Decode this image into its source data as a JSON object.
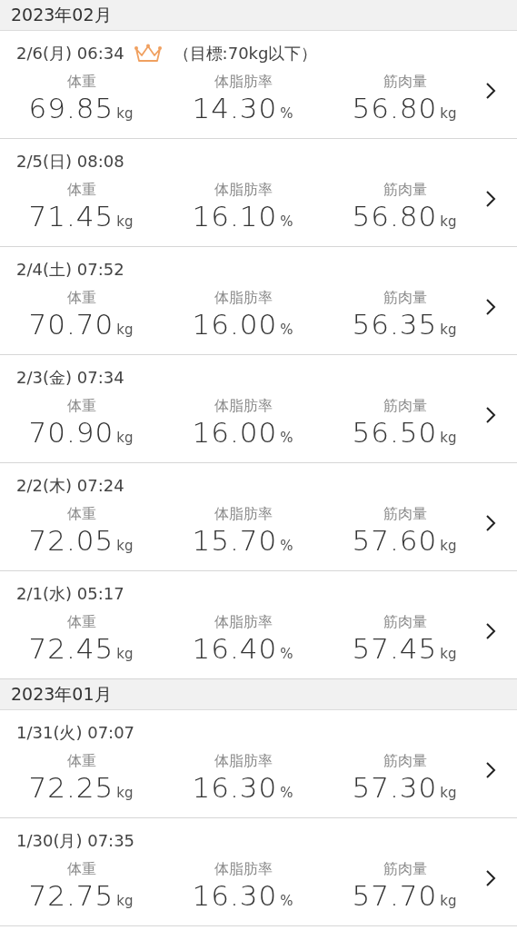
{
  "sections": [
    {
      "month": "2023年02月",
      "records": [
        {
          "datetime": "2/6(月) 06:34",
          "goal": "（目標:70kg以下）",
          "metrics": [
            {
              "label": "体重",
              "value": "69.85",
              "unit": "kg"
            },
            {
              "label": "体脂肪率",
              "value": "14.30",
              "unit": "%"
            },
            {
              "label": "筋肉量",
              "value": "56.80",
              "unit": "kg"
            }
          ]
        },
        {
          "datetime": "2/5(日) 08:08",
          "metrics": [
            {
              "label": "体重",
              "value": "71.45",
              "unit": "kg"
            },
            {
              "label": "体脂肪率",
              "value": "16.10",
              "unit": "%"
            },
            {
              "label": "筋肉量",
              "value": "56.80",
              "unit": "kg"
            }
          ]
        },
        {
          "datetime": "2/4(土) 07:52",
          "metrics": [
            {
              "label": "体重",
              "value": "70.70",
              "unit": "kg"
            },
            {
              "label": "体脂肪率",
              "value": "16.00",
              "unit": "%"
            },
            {
              "label": "筋肉量",
              "value": "56.35",
              "unit": "kg"
            }
          ]
        },
        {
          "datetime": "2/3(金) 07:34",
          "metrics": [
            {
              "label": "体重",
              "value": "70.90",
              "unit": "kg"
            },
            {
              "label": "体脂肪率",
              "value": "16.00",
              "unit": "%"
            },
            {
              "label": "筋肉量",
              "value": "56.50",
              "unit": "kg"
            }
          ]
        },
        {
          "datetime": "2/2(木) 07:24",
          "metrics": [
            {
              "label": "体重",
              "value": "72.05",
              "unit": "kg"
            },
            {
              "label": "体脂肪率",
              "value": "15.70",
              "unit": "%"
            },
            {
              "label": "筋肉量",
              "value": "57.60",
              "unit": "kg"
            }
          ]
        },
        {
          "datetime": "2/1(水) 05:17",
          "metrics": [
            {
              "label": "体重",
              "value": "72.45",
              "unit": "kg"
            },
            {
              "label": "体脂肪率",
              "value": "16.40",
              "unit": "%"
            },
            {
              "label": "筋肉量",
              "value": "57.45",
              "unit": "kg"
            }
          ]
        }
      ]
    },
    {
      "month": "2023年01月",
      "records": [
        {
          "datetime": "1/31(火) 07:07",
          "metrics": [
            {
              "label": "体重",
              "value": "72.25",
              "unit": "kg"
            },
            {
              "label": "体脂肪率",
              "value": "16.30",
              "unit": "%"
            },
            {
              "label": "筋肉量",
              "value": "57.30",
              "unit": "kg"
            }
          ]
        },
        {
          "datetime": "1/30(月) 07:35",
          "metrics": [
            {
              "label": "体重",
              "value": "72.75",
              "unit": "kg"
            },
            {
              "label": "体脂肪率",
              "value": "16.30",
              "unit": "%"
            },
            {
              "label": "筋肉量",
              "value": "57.70",
              "unit": "kg"
            }
          ]
        }
      ]
    }
  ]
}
